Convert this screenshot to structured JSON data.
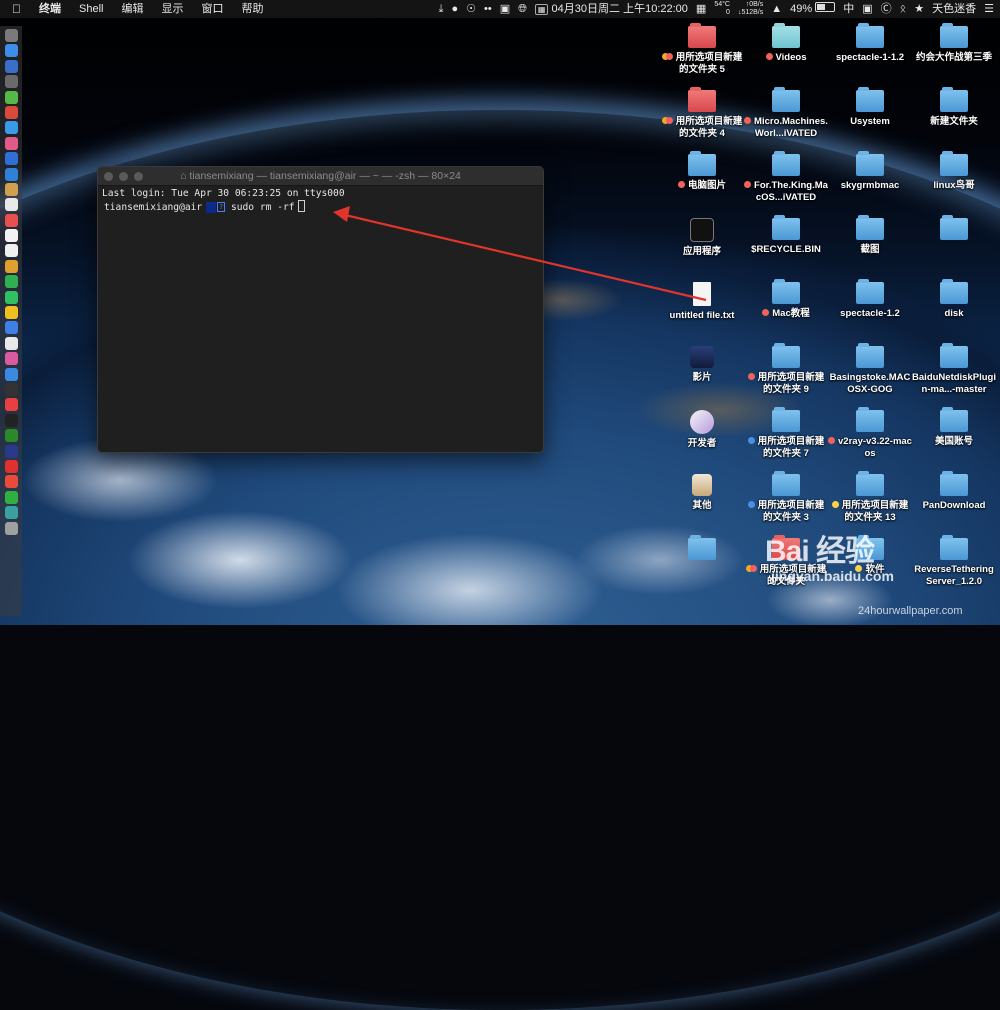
{
  "menubar": {
    "app_menus": [
      "终端",
      "Shell",
      "编辑",
      "显示",
      "窗口",
      "帮助"
    ],
    "status": {
      "cpu_temp": "54°C",
      "cpu_sub": "0",
      "net_up": "↑0B/s",
      "net_down": "↓512B/s",
      "date": "04月30日",
      "weekday": "周二",
      "time": "上午10:22:00",
      "battery": "49%",
      "input_method": "中",
      "user": "天色迷香"
    }
  },
  "terminal": {
    "title": "tiansemixiang — tiansemixiang@air — ~ — -zsh — 80×24",
    "last_login": "Last login: Tue Apr 30 06:23:25 on ttys000",
    "prompt_user": "tiansemixiang@air",
    "prompt_dir": "~",
    "prompt_git": "?",
    "command": "sudo rm -rf"
  },
  "desktop": {
    "items": [
      {
        "label": "用所选项目新建的文件夹 5",
        "kind": "folder-red",
        "tags": [
          "#f5a623",
          "#f0625a"
        ],
        "col": 0,
        "row": 0
      },
      {
        "label": "Videos",
        "kind": "folder-teal",
        "tags": [
          "#f0625a"
        ],
        "col": 1,
        "row": 0
      },
      {
        "label": "spectacle-1-1.2",
        "kind": "folder",
        "tags": [],
        "col": 2,
        "row": 0
      },
      {
        "label": "约会大作战第三季",
        "kind": "folder",
        "tags": [],
        "col": 3,
        "row": 0
      },
      {
        "label": "用所选项目新建的文件夹 4",
        "kind": "folder-red",
        "tags": [
          "#f5a623",
          "#f0625a"
        ],
        "col": 0,
        "row": 1
      },
      {
        "label": "Micro.Machines.Worl...iVATED",
        "kind": "folder",
        "tags": [
          "#f0625a"
        ],
        "col": 1,
        "row": 1
      },
      {
        "label": "Usystem",
        "kind": "folder",
        "tags": [],
        "col": 2,
        "row": 1
      },
      {
        "label": "新建文件夹",
        "kind": "folder",
        "tags": [],
        "col": 3,
        "row": 1
      },
      {
        "label": "电脑图片",
        "kind": "folder",
        "tags": [
          "#f0625a"
        ],
        "col": 0,
        "row": 2
      },
      {
        "label": "For.The.King.MacOS...iVATED",
        "kind": "folder",
        "tags": [
          "#f0625a"
        ],
        "col": 1,
        "row": 2
      },
      {
        "label": "skygrmbmac",
        "kind": "folder",
        "tags": [],
        "col": 2,
        "row": 2
      },
      {
        "label": "linux鸟哥",
        "kind": "folder",
        "tags": [],
        "col": 3,
        "row": 2
      },
      {
        "label": "应用程序",
        "kind": "app-dark",
        "tags": [],
        "col": 0,
        "row": 3
      },
      {
        "label": "$RECYCLE.BIN",
        "kind": "folder",
        "tags": [],
        "col": 1,
        "row": 3
      },
      {
        "label": "截图",
        "kind": "folder",
        "tags": [],
        "col": 2,
        "row": 3
      },
      {
        "label": "",
        "kind": "folder",
        "tags": [],
        "col": 3,
        "row": 3
      },
      {
        "label": "untitled file.txt",
        "kind": "file",
        "tags": [],
        "col": 0,
        "row": 4
      },
      {
        "label": "Mac教程",
        "kind": "folder",
        "tags": [
          "#f0625a"
        ],
        "col": 1,
        "row": 4
      },
      {
        "label": "spectacle-1.2",
        "kind": "folder",
        "tags": [],
        "col": 2,
        "row": 4
      },
      {
        "label": "disk",
        "kind": "folder",
        "tags": [],
        "col": 3,
        "row": 4
      },
      {
        "label": "影片",
        "kind": "app-movie",
        "tags": [],
        "col": 0,
        "row": 5
      },
      {
        "label": "用所选项目新建的文件夹 9",
        "kind": "folder",
        "tags": [
          "#f0625a"
        ],
        "col": 1,
        "row": 5
      },
      {
        "label": "Basingstoke.MACOSX-GOG",
        "kind": "folder",
        "tags": [],
        "col": 2,
        "row": 5
      },
      {
        "label": "BaiduNetdiskPlugin-ma...-master",
        "kind": "folder",
        "tags": [],
        "col": 3,
        "row": 5
      },
      {
        "label": "开发者",
        "kind": "app-dev",
        "tags": [],
        "col": 0,
        "row": 6
      },
      {
        "label": "用所选项目新建的文件夹 7",
        "kind": "folder",
        "tags": [
          "#4a90e2"
        ],
        "col": 1,
        "row": 6
      },
      {
        "label": "v2ray-v3.22-macos",
        "kind": "folder",
        "tags": [
          "#f0625a"
        ],
        "col": 2,
        "row": 6
      },
      {
        "label": "美国账号",
        "kind": "folder",
        "tags": [],
        "col": 3,
        "row": 6
      },
      {
        "label": "其他",
        "kind": "app-other",
        "tags": [],
        "col": 0,
        "row": 7
      },
      {
        "label": "用所选项目新建的文件夹 3",
        "kind": "folder",
        "tags": [
          "#4a90e2"
        ],
        "col": 1,
        "row": 7
      },
      {
        "label": "用所选项目新建的文件夹 13",
        "kind": "folder",
        "tags": [
          "#f8d24a"
        ],
        "col": 2,
        "row": 7
      },
      {
        "label": "PanDownload",
        "kind": "folder",
        "tags": [],
        "col": 3,
        "row": 7
      },
      {
        "label": "",
        "kind": "folder",
        "tags": [],
        "col": 0,
        "row": 8
      },
      {
        "label": "用所选项目新建的文件夹",
        "kind": "folder-red",
        "tags": [
          "#f5a623",
          "#f0625a"
        ],
        "col": 1,
        "row": 8
      },
      {
        "label": "软件",
        "kind": "folder",
        "tags": [
          "#f8d24a"
        ],
        "col": 2,
        "row": 8
      },
      {
        "label": "ReverseTetheringServer_1.2.0",
        "kind": "folder",
        "tags": [],
        "col": 3,
        "row": 8
      }
    ]
  },
  "dock": {
    "icon_colors": [
      "#7a7a7a",
      "#3d8ee8",
      "#3a6fc9",
      "#6a6a6a",
      "#56b847",
      "#d94a3a",
      "#3a9be6",
      "#e05a8a",
      "#2f6fd6",
      "#2f80d8",
      "#d0a050",
      "#e8e8e8",
      "#e84f4f",
      "#f2f2f2",
      "#f0f0f0",
      "#e0a030",
      "#30b050",
      "#30c060",
      "#f0c020",
      "#3f7fe6",
      "#e8e8e8",
      "#d85aa0",
      "#3a8ae0",
      "#333333",
      "#e84040",
      "#222222",
      "#2a8a2a",
      "#2a3a8a",
      "#e03030",
      "#e84b3a",
      "#30b040",
      "#3aa0a0",
      "#a0a0a0"
    ]
  },
  "watermark": {
    "big": "Bai 经验",
    "small": "jingyan.baidu.com",
    "credit": "24hourwallpaper.com"
  }
}
